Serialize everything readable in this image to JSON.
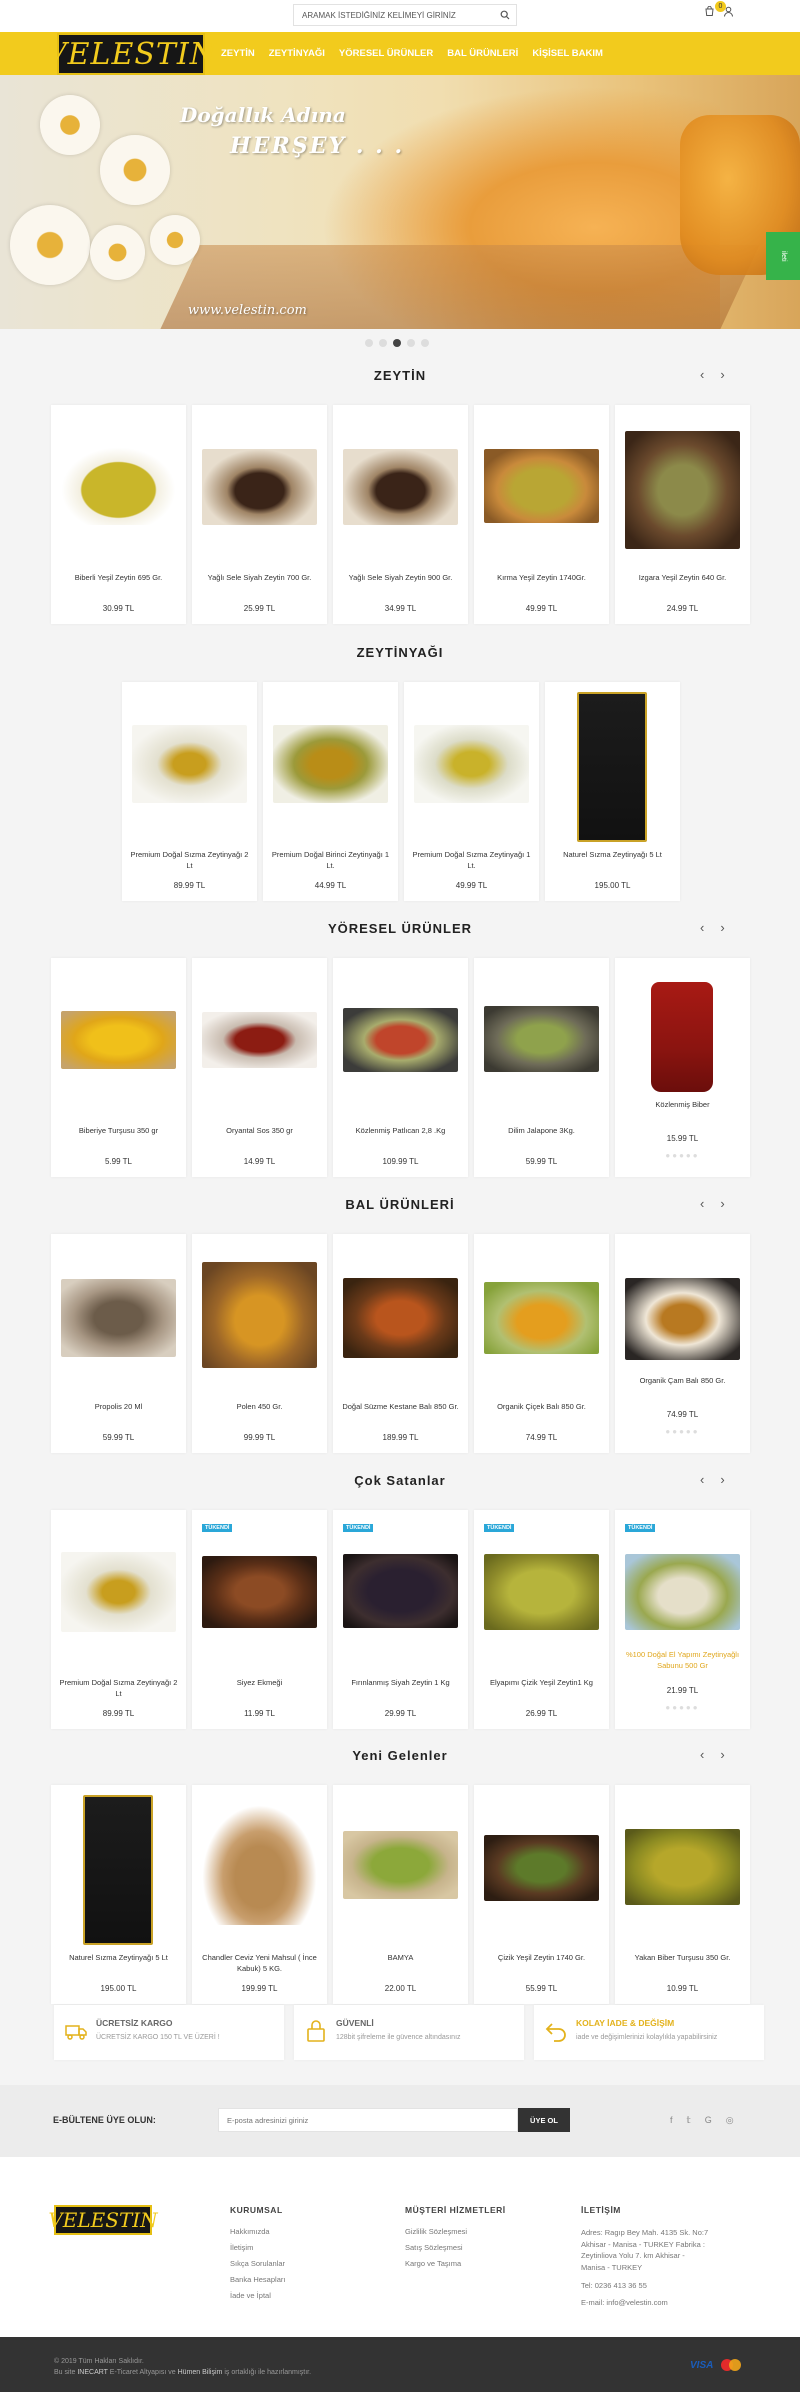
{
  "search": {
    "placeholder": "ARAMAK İSTEDİĞİNİZ KELİMEYİ GİRİNİZ"
  },
  "header": {
    "cart_count": "0",
    "logo": "VELESTIN"
  },
  "menu": [
    "ZEYTİN",
    "ZEYTİNYAĞI",
    "YÖRESEL ÜRÜNLER",
    "BAL ÜRÜNLERİ",
    "KİŞİSEL BAKIM"
  ],
  "hero": {
    "line1": "Doğallık Adına",
    "line2": "HERŞEY . . .",
    "url": "www.velestin.com",
    "side_tab": "ileti"
  },
  "sections": [
    {
      "title": "ZEYTİN",
      "products": [
        {
          "name": "Biberli Yeşil Zeytin 695 Gr.",
          "price": "30.99 TL"
        },
        {
          "name": "Yağlı Sele Siyah Zeytin 700 Gr.",
          "price": "25.99 TL"
        },
        {
          "name": "Yağlı Sele Siyah Zeytin 900 Gr.",
          "price": "34.99 TL"
        },
        {
          "name": "Kırma Yeşil Zeytin 1740Gr.",
          "price": "49.99 TL"
        },
        {
          "name": "Izgara Yeşil Zeytin 640 Gr.",
          "price": "24.99 TL"
        }
      ]
    },
    {
      "title": "ZEYTİNYAĞI",
      "products": [
        {
          "name": "Premium Doğal Sızma Zeytinyağı 2 Lt",
          "price": "89.99 TL"
        },
        {
          "name": "Premium Doğal Birinci Zeytinyağı 1 Lt.",
          "price": "44.99 TL"
        },
        {
          "name": "Premium Doğal Sızma Zeytinyağı 1 Lt.",
          "price": "49.99 TL"
        },
        {
          "name": "Naturel Sızma Zeytinyağı 5 Lt",
          "price": "195.00 TL"
        }
      ]
    },
    {
      "title": "YÖRESEL ÜRÜNLER",
      "products": [
        {
          "name": "Biberiye Turşusu 350 gr",
          "price": "5.99 TL"
        },
        {
          "name": "Oryantal Sos 350 gr",
          "price": "14.99 TL"
        },
        {
          "name": "Közlenmiş Patlıcan 2,8 .Kg",
          "price": "109.99 TL"
        },
        {
          "name": "Dilim Jalapone 3Kg.",
          "price": "59.99 TL"
        },
        {
          "name": "Közlenmiş Biber",
          "price": "15.99 TL"
        }
      ]
    },
    {
      "title": "BAL ÜRÜNLERİ",
      "products": [
        {
          "name": "Propolis 20 Ml",
          "price": "59.99 TL"
        },
        {
          "name": "Polen 450 Gr.",
          "price": "99.99 TL"
        },
        {
          "name": "Doğal Süzme Kestane Balı 850 Gr.",
          "price": "189.99 TL"
        },
        {
          "name": "Organik Çiçek Balı 850 Gr.",
          "price": "74.99 TL"
        },
        {
          "name": "Organik Çam Balı 850 Gr.",
          "price": "74.99 TL"
        }
      ]
    },
    {
      "title": "Çok Satanlar",
      "products": [
        {
          "name": "Premium Doğal Sızma Zeytinyağı 2 Lt",
          "price": "89.99 TL",
          "badge": ""
        },
        {
          "name": "Siyez Ekmeği",
          "price": "11.99 TL",
          "badge": "TÜKENDİ"
        },
        {
          "name": "Fırınlanmış Siyah Zeytin 1 Kg",
          "price": "29.99 TL",
          "badge": "TÜKENDİ"
        },
        {
          "name": "Elyapımı Çizik Yeşil Zeytin1 Kg",
          "price": "26.99 TL",
          "badge": "TÜKENDİ"
        },
        {
          "name": "%100 Doğal El Yapımı Zeytinyağlı Sabunu 500 Gr",
          "price": "21.99 TL",
          "badge": "TÜKENDİ"
        }
      ]
    },
    {
      "title": "Yeni Gelenler",
      "products": [
        {
          "name": "Naturel Sızma Zeytinyağı 5 Lt",
          "price": "195.00 TL"
        },
        {
          "name": "Chandler Ceviz Yeni Mahsul ( İnce Kabuk) 5 KG.",
          "price": "199.99 TL"
        },
        {
          "name": "BAMYA",
          "price": "22.00 TL"
        },
        {
          "name": "Çizik Yeşil Zeytin 1740 Gr.",
          "price": "55.99 TL"
        },
        {
          "name": "Yakan Biber Turşusu 350 Gr.",
          "price": "10.99 TL"
        }
      ]
    }
  ],
  "features": [
    {
      "title": "ÜCRETSİZ KARGO",
      "sub": "ÜCRETSİZ KARGO 150 TL VE ÜZERİ !"
    },
    {
      "title": "GÜVENLİ",
      "sub": "128bit şifreleme ile güvence altındasınız"
    },
    {
      "title": "KOLAY İADE & DEĞİŞİM",
      "sub": "iade ve değişimlerinizi kolaylıkla yapabilirsiniz"
    }
  ],
  "newsletter": {
    "label": "E-BÜLTENE ÜYE OLUN:",
    "placeholder": "E-posta adresinizi giriniz",
    "button": "ÜYE OL"
  },
  "footer": {
    "kurumsal": {
      "title": "KURUMSAL",
      "links": [
        "Hakkımızda",
        "İletişim",
        "Sıkça Sorulanlar",
        "Banka Hesapları",
        "İade ve İptal"
      ]
    },
    "musteri": {
      "title": "MÜŞTERİ HİZMETLERİ",
      "links": [
        "Gizlilik Sözleşmesi",
        "Satış Sözleşmesi",
        "Kargo ve Taşıma"
      ]
    },
    "iletisim": {
      "title": "İLETİŞİM",
      "address": "Adres: Ragıp Bey Mah. 4135 Sk. No:7 Akhisar - Manisa - TURKEY Fabrika : Zeytinliova Yolu 7. km Akhisar - Manisa - TURKEY",
      "phone": "Tel: 0236 413 36 55",
      "email": "E-mail: info@velestin.com"
    }
  },
  "bottom": {
    "copyright": "© 2019 Tüm Hakları Saklıdır.",
    "credit_prefix": "Bu site",
    "credit_brand1": "INECART",
    "credit_mid": "E-Ticaret Altyapısı ve",
    "credit_brand2": "Hümen Bilişim",
    "credit_suffix": "iş ortaklığı ile hazırlanmıştır.",
    "visa": "VISA"
  }
}
